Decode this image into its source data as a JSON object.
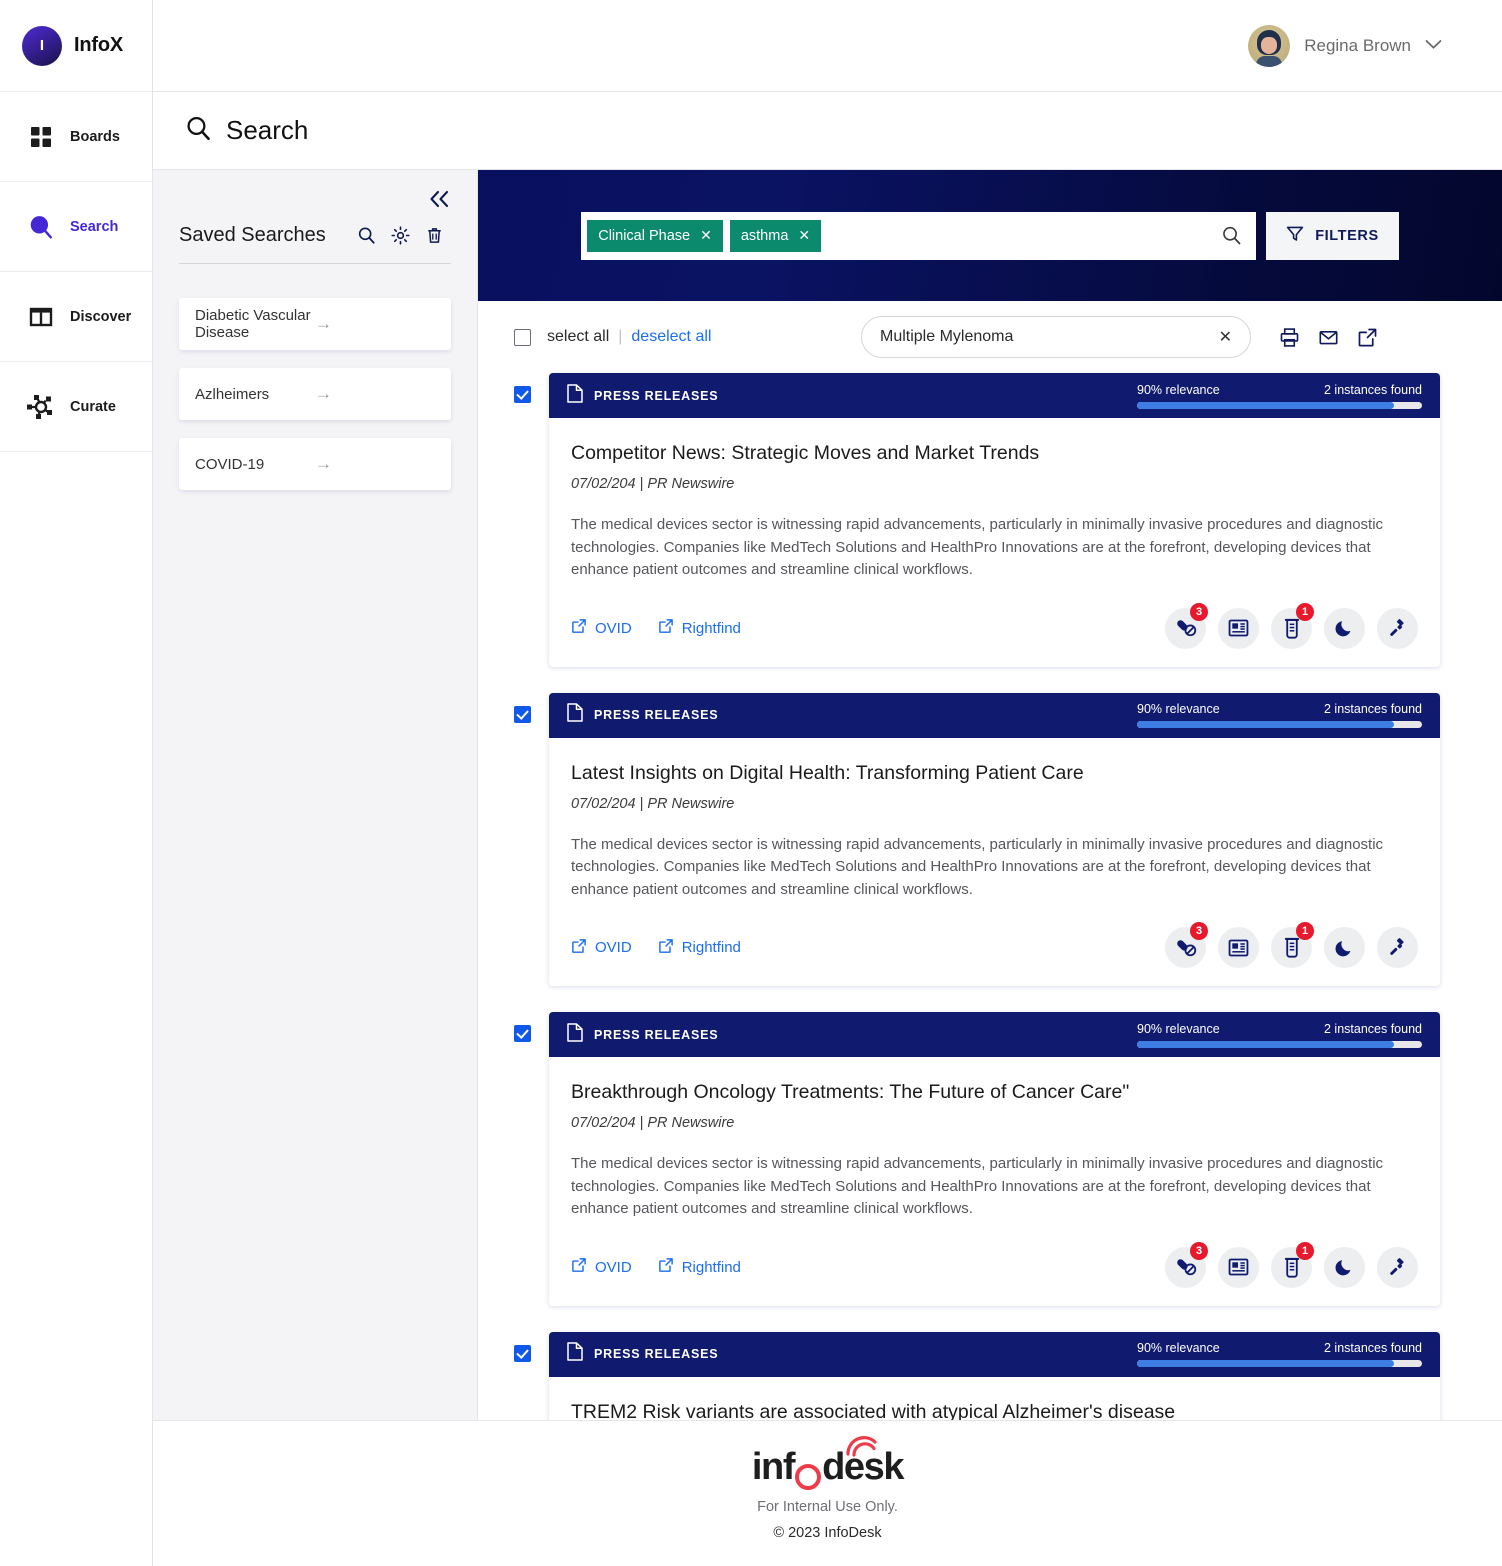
{
  "brand": {
    "initial": "I",
    "name": "InfoX"
  },
  "rail": {
    "items": [
      {
        "label": "Boards",
        "icon": "boards-grid-icon",
        "active": false
      },
      {
        "label": "Search",
        "icon": "search-magnifier-icon",
        "active": true
      },
      {
        "label": "Discover",
        "icon": "discover-panels-icon",
        "active": false
      },
      {
        "label": "Curate",
        "icon": "curate-network-icon",
        "active": false
      }
    ]
  },
  "topbar": {
    "user_name": "Regina Brown",
    "chevron": "chevron-down-icon"
  },
  "page": {
    "title": "Search",
    "title_icon": "search-magnifier-icon"
  },
  "saved_searches": {
    "title": "Saved Searches",
    "collapse_icon": "chevron-double-left-icon",
    "actions": [
      "search-icon",
      "gear-icon",
      "trash-icon"
    ],
    "items": [
      {
        "label": "Diabetic Vascular Disease"
      },
      {
        "label": "Azlheimers"
      },
      {
        "label": "COVID-19"
      }
    ]
  },
  "search_band": {
    "chips": [
      {
        "label": "Clinical Phase",
        "remove": "✕"
      },
      {
        "label": "asthma",
        "remove": "✕"
      }
    ],
    "search_icon": "search-icon",
    "filters_label": "FILTERS",
    "filters_icon": "funnel-icon",
    "chip_color": "#0b8a6d",
    "band_color": "#0a1060"
  },
  "tools": {
    "select_all": "select all",
    "separator": "|",
    "deselect_all": "deselect all",
    "query_value": "Multiple Mylenoma",
    "query_clear": "✕",
    "icons": [
      "print-icon",
      "email-icon",
      "external-link-icon"
    ]
  },
  "results": [
    {
      "type": "PRESS RELEASES",
      "type_icon": "document-icon",
      "relevance": "90% relevance",
      "relevance_pct": 90,
      "instances": "2 instances found",
      "title": "Competitor News: Strategic Moves and Market Trends",
      "meta": "07/02/204 | PR Newswire",
      "text": "The medical devices sector is witnessing rapid advancements, particularly in minimally invasive procedures and diagnostic technologies. Companies like MedTech Solutions and HealthPro Innovations are at the forefront, developing devices that enhance patient outcomes and streamline clinical workflows.",
      "links": [
        {
          "label": "OVID"
        },
        {
          "label": "Rightfind"
        }
      ],
      "actions": [
        {
          "icon": "pill-blocked-icon",
          "badge": "3"
        },
        {
          "icon": "news-article-icon",
          "badge": ""
        },
        {
          "icon": "test-tube-icon",
          "badge": "1"
        },
        {
          "icon": "moon-icon",
          "badge": ""
        },
        {
          "icon": "gavel-icon",
          "badge": ""
        }
      ],
      "checked": true
    },
    {
      "type": "PRESS RELEASES",
      "type_icon": "document-icon",
      "relevance": "90% relevance",
      "relevance_pct": 90,
      "instances": "2 instances found",
      "title": "Latest Insights on Digital Health: Transforming Patient Care",
      "meta": "07/02/204 | PR Newswire",
      "text": "The medical devices sector is witnessing rapid advancements, particularly in minimally invasive procedures and diagnostic technologies. Companies like MedTech Solutions and HealthPro Innovations are at the forefront, developing devices that enhance patient outcomes and streamline clinical workflows.",
      "links": [
        {
          "label": "OVID"
        },
        {
          "label": "Rightfind"
        }
      ],
      "actions": [
        {
          "icon": "pill-blocked-icon",
          "badge": "3"
        },
        {
          "icon": "news-article-icon",
          "badge": ""
        },
        {
          "icon": "test-tube-icon",
          "badge": "1"
        },
        {
          "icon": "moon-icon",
          "badge": ""
        },
        {
          "icon": "gavel-icon",
          "badge": ""
        }
      ],
      "checked": true
    },
    {
      "type": "PRESS RELEASES",
      "type_icon": "document-icon",
      "relevance": "90% relevance",
      "relevance_pct": 90,
      "instances": "2 instances found",
      "title": "Breakthrough Oncology Treatments: The Future of Cancer Care\"",
      "meta": "07/02/204 | PR Newswire",
      "text": "The medical devices sector is witnessing rapid advancements, particularly in minimally invasive procedures and diagnostic technologies. Companies like MedTech Solutions and HealthPro Innovations are at the forefront, developing devices that enhance patient outcomes and streamline clinical workflows.",
      "links": [
        {
          "label": "OVID"
        },
        {
          "label": "Rightfind"
        }
      ],
      "actions": [
        {
          "icon": "pill-blocked-icon",
          "badge": "3"
        },
        {
          "icon": "news-article-icon",
          "badge": ""
        },
        {
          "icon": "test-tube-icon",
          "badge": "1"
        },
        {
          "icon": "moon-icon",
          "badge": ""
        },
        {
          "icon": "gavel-icon",
          "badge": ""
        }
      ],
      "checked": true
    },
    {
      "type": "PRESS RELEASES",
      "type_icon": "document-icon",
      "relevance": "90% relevance",
      "relevance_pct": 90,
      "instances": "2 instances found",
      "title": "TREM2 Risk variants  are associated with atypical Alzheimer's disease",
      "meta": "",
      "text": "",
      "links": [],
      "actions": [],
      "checked": true
    }
  ],
  "footer": {
    "logo_pre": "inf",
    "logo_post": "desk",
    "line1": "For Internal Use Only.",
    "line2": "© 2023 InfoDesk",
    "accent": "#ee3b4a"
  }
}
